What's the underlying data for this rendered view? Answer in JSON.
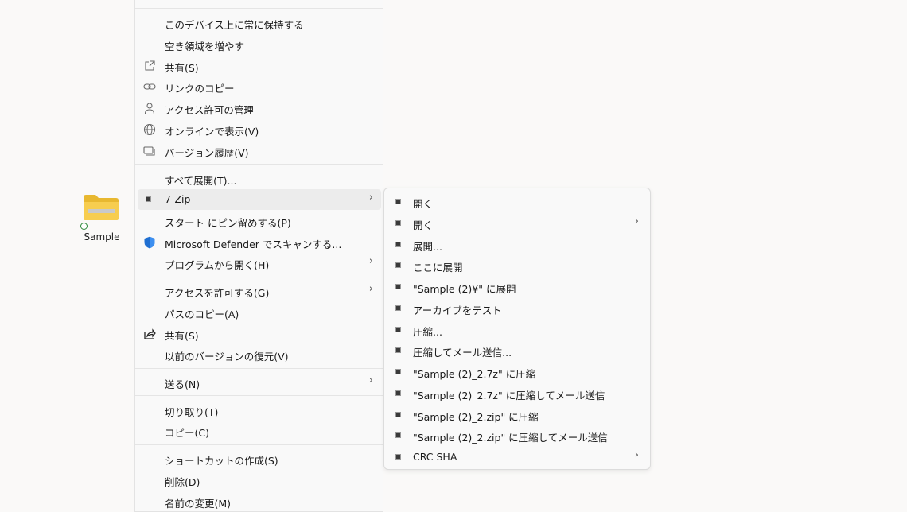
{
  "desktop": {
    "folder_label": "Sample"
  },
  "menu": {
    "items": [
      {
        "label": "このデバイス上に常に保持する"
      },
      {
        "label": "空き領域を増やす"
      },
      {
        "label": "共有(S)"
      },
      {
        "label": "リンクのコピー"
      },
      {
        "label": "アクセス許可の管理"
      },
      {
        "label": "オンラインで表示(V)"
      },
      {
        "label": "バージョン履歴(V)"
      },
      {
        "label": "すべて展開(T)..."
      },
      {
        "label": "7-Zip"
      },
      {
        "label": "スタート にピン留めする(P)"
      },
      {
        "label": "Microsoft Defender でスキャンする..."
      },
      {
        "label": "プログラムから開く(H)"
      },
      {
        "label": "アクセスを許可する(G)"
      },
      {
        "label": "パスのコピー(A)"
      },
      {
        "label": "共有(S)"
      },
      {
        "label": "以前のバージョンの復元(V)"
      },
      {
        "label": "送る(N)"
      },
      {
        "label": "切り取り(T)"
      },
      {
        "label": "コピー(C)"
      },
      {
        "label": "ショートカットの作成(S)"
      },
      {
        "label": "削除(D)"
      },
      {
        "label": "名前の変更(M)"
      }
    ]
  },
  "submenu": {
    "items": [
      {
        "label": "開く"
      },
      {
        "label": "開く"
      },
      {
        "label": "展開..."
      },
      {
        "label": "ここに展開"
      },
      {
        "label": "\"Sample (2)¥\" に展開"
      },
      {
        "label": "アーカイブをテスト"
      },
      {
        "label": "圧縮..."
      },
      {
        "label": "圧縮してメール送信..."
      },
      {
        "label": "\"Sample (2)_2.7z\" に圧縮"
      },
      {
        "label": "\"Sample (2)_2.7z\" に圧縮してメール送信"
      },
      {
        "label": "\"Sample (2)_2.zip\" に圧縮"
      },
      {
        "label": "\"Sample (2)_2.zip\" に圧縮してメール送信"
      },
      {
        "label": "CRC SHA"
      }
    ]
  },
  "colors": {
    "folder": "#f4c542",
    "defender": "#1f6fd1",
    "hover": "#ececec"
  }
}
